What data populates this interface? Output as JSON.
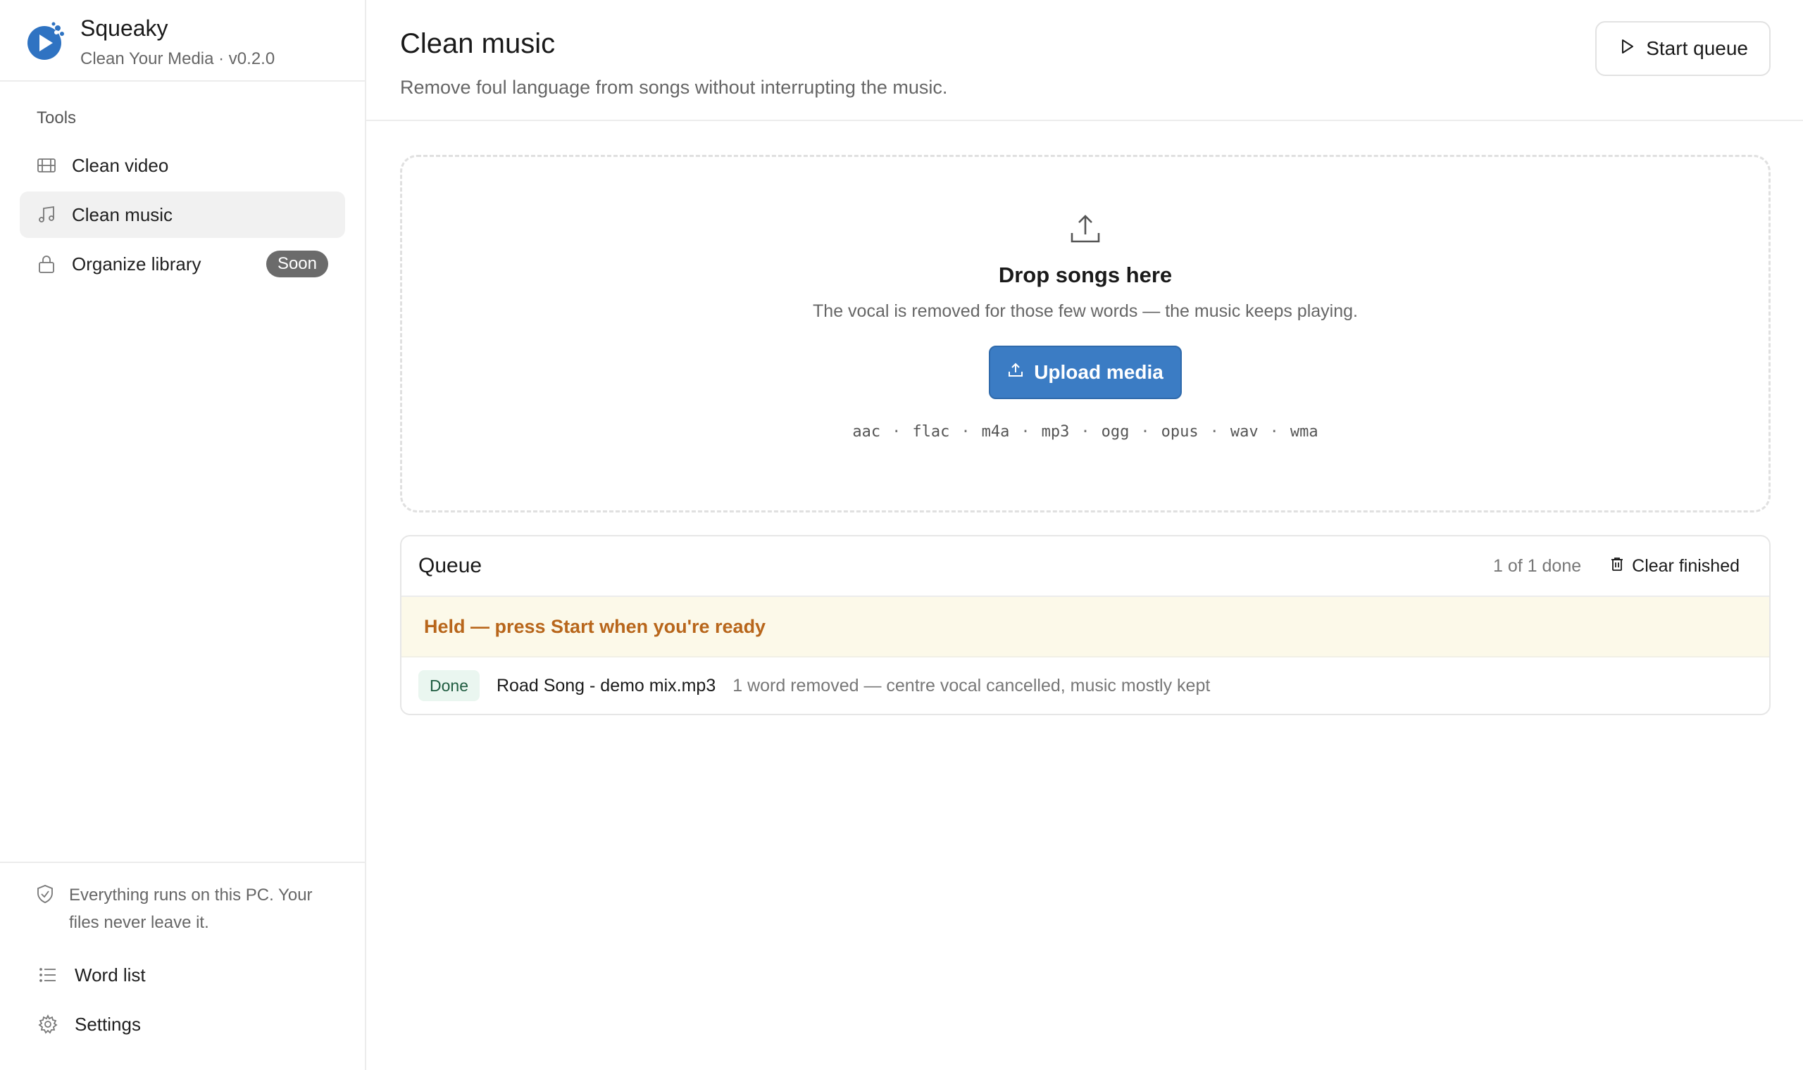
{
  "app": {
    "name": "Squeaky",
    "subtitle": "Clean Your Media · v0.2.0",
    "accent_color": "#3b7cc4"
  },
  "sidebar": {
    "heading": "Tools",
    "items": [
      {
        "label": "Clean video",
        "icon": "film-icon",
        "active": false
      },
      {
        "label": "Clean music",
        "icon": "music-note-icon",
        "active": true
      },
      {
        "label": "Organize library",
        "icon": "lock-icon",
        "active": false,
        "badge": "Soon"
      }
    ],
    "privacy_note": "Everything runs on this PC. Your files never leave it.",
    "footer_items": [
      {
        "label": "Word list",
        "icon": "list-icon"
      },
      {
        "label": "Settings",
        "icon": "gear-icon"
      }
    ]
  },
  "header": {
    "title": "Clean music",
    "subtitle": "Remove foul language from songs without interrupting the music.",
    "start_button": "Start queue"
  },
  "dropzone": {
    "title": "Drop songs here",
    "description": "The vocal is removed for those few words — the music keeps playing.",
    "upload_button": "Upload media",
    "formats": [
      "aac",
      "flac",
      "m4a",
      "mp3",
      "ogg",
      "opus",
      "wav",
      "wma"
    ]
  },
  "queue": {
    "title": "Queue",
    "count": "1 of 1 done",
    "clear_button": "Clear finished",
    "held_message": "Held — press Start when you're ready",
    "items": [
      {
        "status": "Done",
        "file": "Road Song - demo mix.mp3",
        "detail": "1 word removed — centre vocal cancelled, music mostly kept"
      }
    ]
  }
}
